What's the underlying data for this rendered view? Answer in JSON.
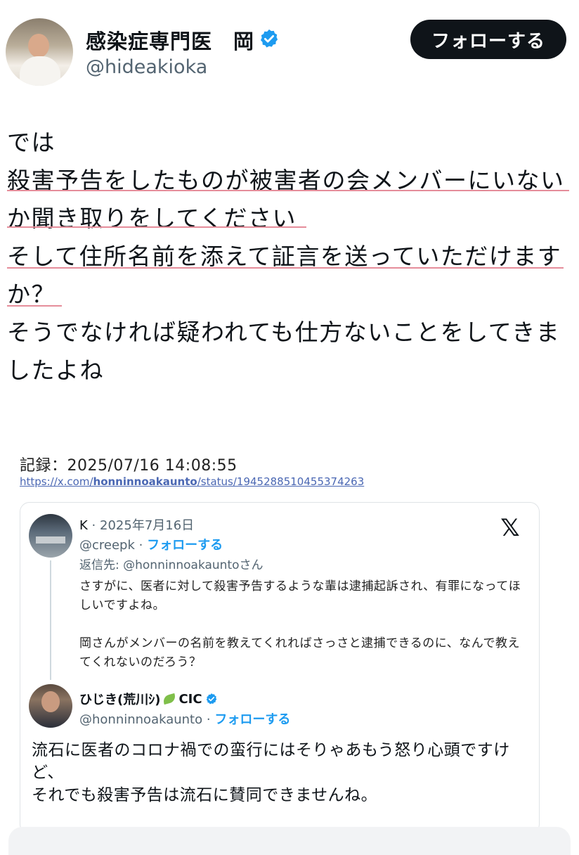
{
  "author": {
    "display_name": "感染症専門医　岡",
    "handle": "@hideakioka",
    "follow_label": "フォローする"
  },
  "post": {
    "lines": [
      "では",
      "殺害予告をしたものが被害者の会メンバーにいない",
      "か聞き取りをしてください",
      "そして住所名前を添えて証言を送っていただけます",
      "か？",
      "そうでなければ疑われても仕方ないことをしてきま",
      "したよね"
    ]
  },
  "record": {
    "label": "記録：2025/07/16 14:08:55",
    "link_prefix": "https://x.com/",
    "link_account": "honninnoakaunto",
    "link_suffix": "/status/1945288510455374263"
  },
  "embed": {
    "reply": {
      "name": "K",
      "separator": "·",
      "date": "2025年7月16日",
      "handle": "@creepk",
      "follow_label": "フォローする",
      "reply_to": "返信先: @honninnoakauntoさん",
      "paragraph1": "さすがに、医者に対して殺害予告するような輩は逮捕起訴され、有罪になってほしいですよね。",
      "paragraph2": "岡さんがメンバーの名前を教えてくれればさっさと逮捕できるのに、なんで教えてくれないのだろう？"
    },
    "main": {
      "name": "ひじき(荒川ｼ)",
      "name_suffix": "CIC",
      "handle": "@honninnoakaunto",
      "follow_label": "フォローする",
      "line1": "流石に医者のコロナ禍での蛮行にはそりゃあもう怒り心頭ですけど、",
      "line2": "それでも殺害予告は流石に賛同できませんね。"
    },
    "platform_icon": "x-logo-icon"
  },
  "colors": {
    "accent_blue": "#1d9bf0",
    "underline_pink": "#e58d9a",
    "follow_button_bg": "#0f1419"
  }
}
